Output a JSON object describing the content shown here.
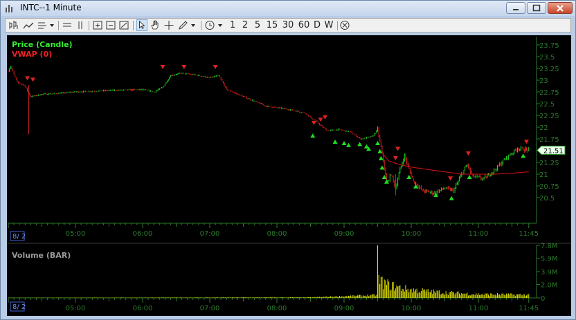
{
  "window": {
    "title": "INTC--1 Minute"
  },
  "toolbar": {
    "timeframes": [
      "1",
      "2",
      "5",
      "15",
      "30",
      "60",
      "D",
      "W"
    ]
  },
  "colors": {
    "up": "#22dd22",
    "down": "#dd2222",
    "vwap": "#dd1111",
    "volume": "#e8e800",
    "axis": "#2b7a2b",
    "label_green": "#33ee33"
  },
  "chart_data": [
    {
      "type": "candlestick",
      "title": "",
      "series_labels": [
        "Price (Candle)",
        "VWAP (0)"
      ],
      "ylim": [
        20.35,
        23.85
      ],
      "y_ticks": [
        "23.75",
        "23.5",
        "23.25",
        "23",
        "22.75",
        "22.5",
        "22.25",
        "22",
        "21.75",
        "21.5",
        "21.25",
        "21",
        "20.75",
        "20.5"
      ],
      "x_ticks": [
        "05:00",
        "06:00",
        "07:00",
        "08:00",
        "09:00",
        "10:00",
        "11:00",
        "11:45"
      ],
      "date_label": "8/ 2",
      "last_price": "21.51",
      "price_path": [
        [
          "04:00",
          23.2
        ],
        [
          "04:02",
          23.3
        ],
        [
          "04:08",
          22.95
        ],
        [
          "04:14",
          22.9
        ],
        [
          "04:20",
          22.65
        ],
        [
          "04:30",
          22.7
        ],
        [
          "04:45",
          22.72
        ],
        [
          "05:00",
          22.75
        ],
        [
          "05:30",
          22.78
        ],
        [
          "06:00",
          22.8
        ],
        [
          "06:10",
          22.75
        ],
        [
          "06:18",
          22.85
        ],
        [
          "06:25",
          23.1
        ],
        [
          "06:35",
          23.15
        ],
        [
          "06:50",
          23.1
        ],
        [
          "07:00",
          23.05
        ],
        [
          "07:08",
          23.1
        ],
        [
          "07:15",
          22.8
        ],
        [
          "07:30",
          22.65
        ],
        [
          "07:50",
          22.45
        ],
        [
          "08:10",
          22.38
        ],
        [
          "08:25",
          22.3
        ],
        [
          "08:35",
          22.12
        ],
        [
          "08:45",
          21.92
        ],
        [
          "08:55",
          21.95
        ],
        [
          "09:05",
          21.9
        ],
        [
          "09:15",
          21.75
        ],
        [
          "09:25",
          21.8
        ],
        [
          "09:30",
          21.95
        ],
        [
          "09:32",
          21.7
        ],
        [
          "09:35",
          21.3
        ],
        [
          "09:38",
          20.8
        ],
        [
          "09:42",
          21.0
        ],
        [
          "09:46",
          20.7
        ],
        [
          "09:50",
          21.1
        ],
        [
          "09:54",
          21.4
        ],
        [
          "09:58",
          21.1
        ],
        [
          "10:02",
          20.85
        ],
        [
          "10:10",
          20.65
        ],
        [
          "10:20",
          20.6
        ],
        [
          "10:30",
          20.7
        ],
        [
          "10:38",
          20.65
        ],
        [
          "10:45",
          21.0
        ],
        [
          "10:50",
          21.2
        ],
        [
          "10:55",
          20.95
        ],
        [
          "11:05",
          20.9
        ],
        [
          "11:15",
          21.1
        ],
        [
          "11:25",
          21.35
        ],
        [
          "11:35",
          21.55
        ],
        [
          "11:45",
          21.51
        ]
      ],
      "vwap_path": [
        [
          "09:32",
          21.5
        ],
        [
          "09:40",
          21.28
        ],
        [
          "09:50",
          21.2
        ],
        [
          "10:00",
          21.15
        ],
        [
          "10:15",
          21.1
        ],
        [
          "10:30",
          21.05
        ],
        [
          "10:45",
          21.0
        ],
        [
          "11:00",
          21.0
        ],
        [
          "11:15",
          21.0
        ],
        [
          "11:30",
          21.02
        ],
        [
          "11:45",
          21.05
        ]
      ],
      "down_markers": [
        [
          "04:17",
          22.98
        ],
        [
          "04:22",
          22.95
        ],
        [
          "06:18",
          23.22
        ],
        [
          "06:37",
          23.22
        ],
        [
          "07:05",
          23.22
        ],
        [
          "08:33",
          22.03
        ],
        [
          "08:39",
          22.1
        ],
        [
          "08:43",
          22.15
        ],
        [
          "09:46",
          21.28
        ],
        [
          "09:48",
          21.48
        ],
        [
          "10:35",
          20.85
        ],
        [
          "10:51",
          21.38
        ],
        [
          "11:43",
          21.63
        ]
      ],
      "up_markers": [
        [
          "08:32",
          21.88
        ],
        [
          "08:52",
          21.75
        ],
        [
          "09:00",
          21.72
        ],
        [
          "09:04",
          21.68
        ],
        [
          "09:14",
          21.7
        ],
        [
          "09:20",
          21.65
        ],
        [
          "09:22",
          21.6
        ],
        [
          "09:30",
          21.72
        ],
        [
          "09:32",
          21.55
        ],
        [
          "09:33",
          21.4
        ],
        [
          "09:34",
          21.2
        ],
        [
          "09:36",
          21.0
        ],
        [
          "09:38",
          20.9
        ],
        [
          "09:58",
          21.0
        ],
        [
          "10:04",
          20.8
        ],
        [
          "10:22",
          20.62
        ],
        [
          "10:36",
          20.55
        ],
        [
          "10:52",
          21.0
        ],
        [
          "11:40",
          21.45
        ]
      ]
    },
    {
      "type": "bar",
      "title": "",
      "series_labels": [
        "Volume (BAR)"
      ],
      "ylim": [
        0,
        8000000
      ],
      "y_ticks": [
        "7.8M",
        "5.9M",
        "3.9M",
        "2.0M",
        "0"
      ],
      "x_ticks": [
        "05:00",
        "06:00",
        "07:00",
        "08:00",
        "09:00",
        "10:00",
        "11:00",
        "11:45"
      ],
      "date_label": "8/ 2",
      "volume_profile": [
        [
          "04:00",
          20000
        ],
        [
          "08:30",
          80000
        ],
        [
          "09:00",
          250000
        ],
        [
          "09:29",
          400000
        ],
        [
          "09:30",
          7800000
        ],
        [
          "09:31",
          2600000
        ],
        [
          "09:34",
          2300000
        ],
        [
          "09:40",
          1900000
        ],
        [
          "09:50",
          1500000
        ],
        [
          "10:00",
          1200000
        ],
        [
          "10:20",
          900000
        ],
        [
          "10:40",
          700000
        ],
        [
          "11:00",
          550000
        ],
        [
          "11:45",
          450000
        ]
      ]
    }
  ]
}
